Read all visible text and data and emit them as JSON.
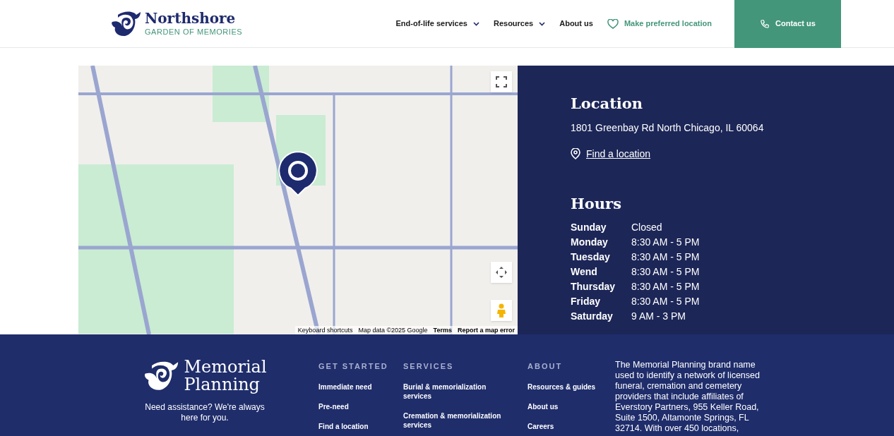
{
  "header": {
    "logo": {
      "name": "Northshore",
      "tagline": "GARDEN OF MEMORIES"
    },
    "nav": [
      {
        "label": "End-of-life services",
        "kind": "dropdown"
      },
      {
        "label": "Resources",
        "kind": "dropdown"
      },
      {
        "label": "About us",
        "kind": "link"
      },
      {
        "label": "Make preferred location",
        "kind": "favorite"
      }
    ],
    "contact_button": "Contact us"
  },
  "map": {
    "attribution": [
      "Keyboard shortcuts",
      "Map data ©2025 Google",
      "Terms",
      "Report a map error"
    ]
  },
  "location": {
    "title": "Location",
    "address": "1801 Greenbay Rd North Chicago, IL 60064",
    "link": "Find a location"
  },
  "hours": {
    "title": "Hours",
    "rows": [
      {
        "day": "Sunday",
        "time": "Closed"
      },
      {
        "day": "Monday",
        "time": "8:30 AM - 5 PM"
      },
      {
        "day": "Tuesday",
        "time": "8:30 AM - 5 PM"
      },
      {
        "day": "Wend",
        "time": "8:30 AM - 5 PM"
      },
      {
        "day": "Thursday",
        "time": "8:30 AM - 5 PM"
      },
      {
        "day": "Friday",
        "time": "8:30 AM - 5 PM"
      },
      {
        "day": "Saturday",
        "time": "9 AM - 3 PM"
      }
    ]
  },
  "footer": {
    "logo": {
      "line1": "Memorial",
      "line2": "Planning"
    },
    "tagline": "Need assistance? We're always here for you.",
    "columns": [
      {
        "heading": "GET STARTED",
        "links": [
          "Immediate need",
          "Pre-need",
          "Find a location"
        ]
      },
      {
        "heading": "SERVICES",
        "links": [
          "Burial & memorialization services",
          "Cremation & memorialization services"
        ]
      },
      {
        "heading": "ABOUT",
        "links": [
          "Resources & guides",
          "About us",
          "Careers"
        ]
      }
    ],
    "disclaimer": "The Memorial Planning brand name used to identify a network of licensed funeral, cremation and cemetery providers that include affiliates of Everstory Partners, 955 Keller Road, Suite 1500, Altamonte Springs, FL 32714. With over 450 locations,"
  }
}
